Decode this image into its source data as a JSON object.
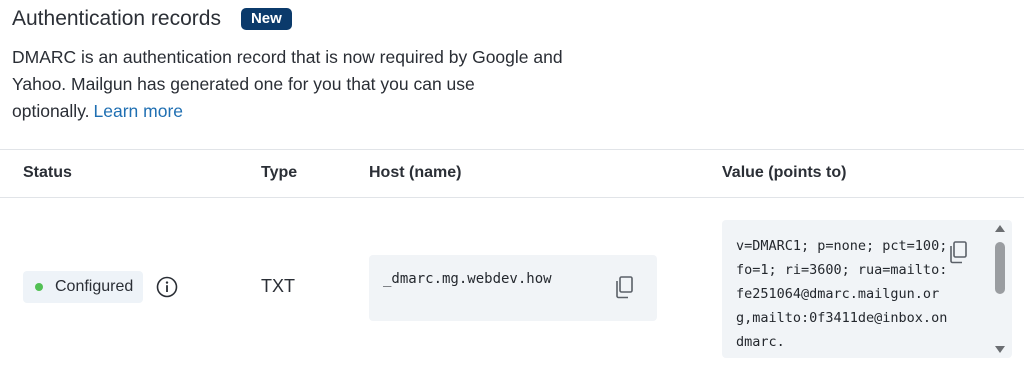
{
  "header": {
    "title": "Authentication records",
    "badge": "New"
  },
  "description": {
    "text": "DMARC is an authentication record that is now required by Google and Yahoo. Mailgun has generated one for you that you can use optionally.",
    "link": "Learn more"
  },
  "table": {
    "columns": [
      "Status",
      "Type",
      "Host (name)",
      "Value (points to)"
    ],
    "row": {
      "status": "Configured",
      "type": "TXT",
      "host": "_dmarc.mg.webdev.how",
      "value": "v=DMARC1; p=none; pct=100; fo=1; ri=3600; rua=mailto:fe251064@dmarc.mailgun.org,mailto:0f3411de@inbox.ondmarc."
    }
  },
  "icons": {
    "info": "info-icon",
    "copy": "copy-icon",
    "status_dot": "status-dot-icon"
  },
  "colors": {
    "badge_bg": "#0b3a6b",
    "link": "#1f6fb2",
    "status_ok": "#52c054"
  }
}
